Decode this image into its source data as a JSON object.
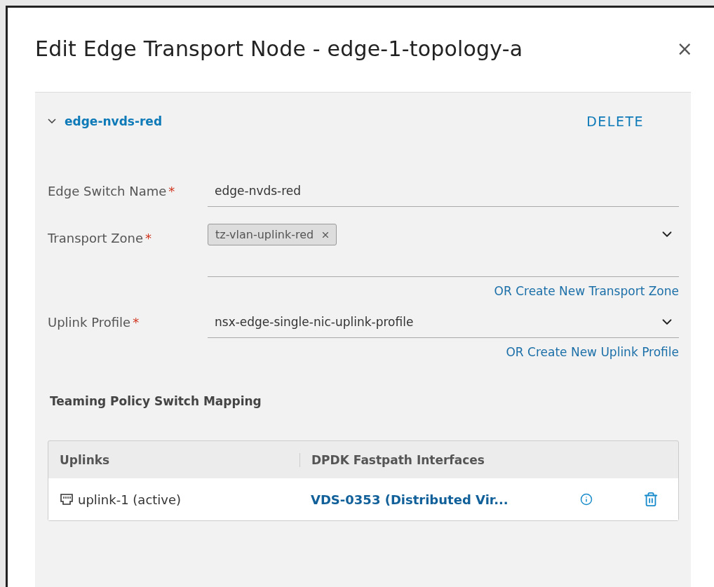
{
  "dialog": {
    "title": "Edit Edge Transport Node - edge-1-topology-a",
    "close": "×"
  },
  "section": {
    "title": "edge-nvds-red",
    "expanded": true,
    "action": "DELETE",
    "fields": [
      {
        "kind": "text",
        "label": "Edge Switch Name",
        "required_mark": "*",
        "value": "edge-nvds-red"
      },
      {
        "kind": "tags",
        "label": "Transport Zone",
        "required_mark": "*",
        "tags": [
          "tz-vlan-uplink-red"
        ],
        "link": "OR Create New Transport Zone"
      },
      {
        "kind": "select",
        "label": "Uplink Profile",
        "required_mark": "*",
        "value": "nsx-edge-single-nic-uplink-profile",
        "link": "OR Create New Uplink Profile"
      }
    ],
    "mapping": {
      "title": "Teaming Policy Switch Mapping",
      "columns": [
        "Uplinks",
        "DPDK Fastpath Interfaces"
      ],
      "rows": [
        {
          "uplink": "uplink-1 (active)",
          "interface": "VDS-0353 (Distributed Vir..."
        }
      ]
    }
  }
}
